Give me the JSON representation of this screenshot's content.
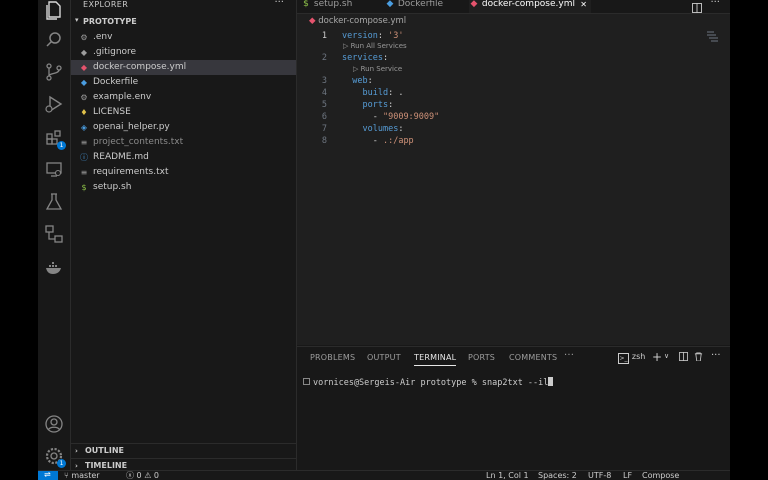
{
  "sidebar": {
    "title": "EXPLORER",
    "more": "···",
    "folder": "PROTOTYPE",
    "files": [
      {
        "name": ".env",
        "icon": "gear-icon",
        "glyph": "⚙",
        "color": "#9d9d9d"
      },
      {
        "name": ".gitignore",
        "icon": "git-icon",
        "glyph": "◆",
        "color": "#9d9d9d"
      },
      {
        "name": "docker-compose.yml",
        "icon": "docker-icon",
        "glyph": "🐳",
        "color": "#e5536d"
      },
      {
        "name": "Dockerfile",
        "icon": "docker-icon",
        "glyph": "🐳",
        "color": "#4a9de0"
      },
      {
        "name": "example.env",
        "icon": "gear-icon",
        "glyph": "⚙",
        "color": "#9d9d9d"
      },
      {
        "name": "LICENSE",
        "icon": "license-icon",
        "glyph": "♦",
        "color": "#e0c14a"
      },
      {
        "name": "openai_helper.py",
        "icon": "python-icon",
        "glyph": "◈",
        "color": "#4a9de0"
      },
      {
        "name": "project_contents.txt",
        "icon": "text-file-icon",
        "glyph": "≡",
        "color": "#9d9d9d"
      },
      {
        "name": "README.md",
        "icon": "info-icon",
        "glyph": "ⓘ",
        "color": "#4a9de0"
      },
      {
        "name": "requirements.txt",
        "icon": "text-file-icon",
        "glyph": "≡",
        "color": "#9d9d9d"
      },
      {
        "name": "setup.sh",
        "icon": "shell-icon",
        "glyph": "$",
        "color": "#8dc149"
      }
    ],
    "outline": "OUTLINE",
    "timeline": "TIMELINE"
  },
  "tabs": [
    {
      "label": "setup.sh",
      "glyph": "$",
      "color": "#8dc149"
    },
    {
      "label": "Dockerfile",
      "glyph": "🐳",
      "color": "#4a9de0"
    },
    {
      "label": "docker-compose.yml",
      "glyph": "🐳",
      "color": "#e5536d",
      "close": "✕"
    }
  ],
  "editor": {
    "breadcrumb": "docker-compose.yml",
    "codelens_all": "Run All Services",
    "codelens_service": "Run Service",
    "lines": [
      {
        "n": "1",
        "key": "version",
        "val": "'3'"
      },
      {
        "n": "2",
        "key": "services",
        "val": ""
      },
      {
        "n": "3",
        "key": "web",
        "val": ""
      },
      {
        "n": "4",
        "key": "build",
        "val": "."
      },
      {
        "n": "5",
        "key": "ports",
        "val": ""
      },
      {
        "n": "6",
        "key": "",
        "val": "\"9009:9009\""
      },
      {
        "n": "7",
        "key": "volumes",
        "val": ""
      },
      {
        "n": "8",
        "key": "",
        "val": ".:/app"
      }
    ]
  },
  "panel": {
    "tabs": [
      "PROBLEMS",
      "OUTPUT",
      "TERMINAL",
      "PORTS",
      "COMMENTS"
    ],
    "more": "···",
    "shell": "zsh",
    "prompt": "vornices@Sergeis-Air prototype % snap2txt --il"
  },
  "status": {
    "branch": "master",
    "errors": "0",
    "warnings": "0",
    "position": "Ln 1, Col 1",
    "spaces": "Spaces: 2",
    "encoding": "UTF-8",
    "eol": "LF",
    "language": "Compose"
  },
  "badges": {
    "extensions": "1",
    "settings": "1"
  }
}
